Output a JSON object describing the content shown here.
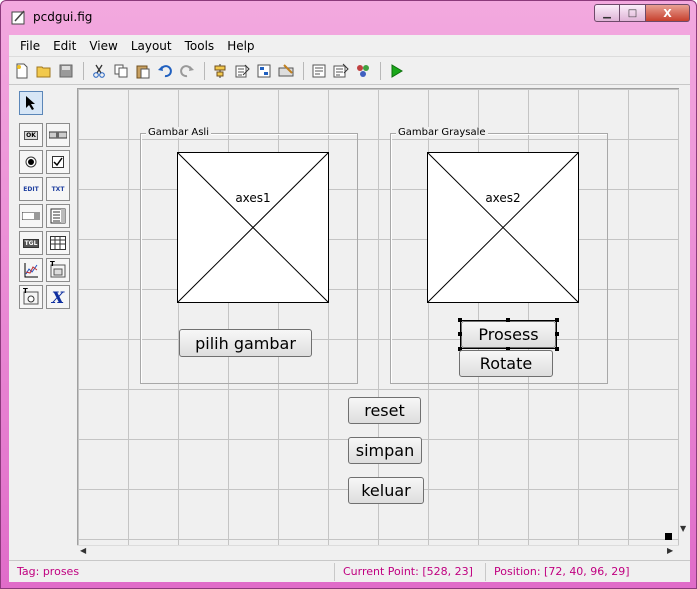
{
  "window": {
    "title": "pcdgui.fig",
    "minimize_glyph": "▁",
    "maximize_glyph": "□",
    "close_glyph": "X"
  },
  "menu": [
    "File",
    "Edit",
    "View",
    "Layout",
    "Tools",
    "Help"
  ],
  "toolbar": {
    "icons": [
      "new-file-icon",
      "open-folder-icon",
      "save-icon",
      "cut-icon",
      "copy-icon",
      "paste-icon",
      "undo-icon",
      "redo-icon",
      "align-icon",
      "menu-editor-icon",
      "tab-order-icon",
      "toolbar-editor-icon",
      "editor-icon",
      "property-inspector-icon",
      "object-browser-icon",
      "run-icon"
    ],
    "run_color": "#1aa81a"
  },
  "palette": {
    "items": [
      {
        "name": "pushbutton-tool",
        "label": "OK"
      },
      {
        "name": "slider-tool",
        "label": ""
      },
      {
        "name": "radiobutton-tool",
        "label": ""
      },
      {
        "name": "checkbox-tool",
        "label": ""
      },
      {
        "name": "edit-text-tool",
        "label": "EDIT"
      },
      {
        "name": "static-text-tool",
        "label": "TXT"
      },
      {
        "name": "popup-menu-tool",
        "label": ""
      },
      {
        "name": "listbox-tool",
        "label": ""
      },
      {
        "name": "toggle-button-tool",
        "label": "TGL"
      },
      {
        "name": "table-tool",
        "label": ""
      },
      {
        "name": "axes-tool",
        "label": ""
      },
      {
        "name": "panel-tool",
        "label": "T"
      },
      {
        "name": "button-group-tool",
        "label": "T"
      },
      {
        "name": "activex-tool",
        "label": "X"
      }
    ]
  },
  "layout": {
    "panels": [
      {
        "title": "Gambar Asli",
        "axes_label": "axes1",
        "button": "pilih gambar"
      },
      {
        "title": "Gambar Graysale",
        "axes_label": "axes2",
        "buttons": [
          "Prosess",
          "Rotate"
        ]
      }
    ],
    "buttons": [
      "reset",
      "simpan",
      "keluar"
    ]
  },
  "status": {
    "tag": "Tag: proses",
    "current_point": "Current Point:  [528, 23]",
    "position": "Position: [72, 40, 96, 29]"
  }
}
